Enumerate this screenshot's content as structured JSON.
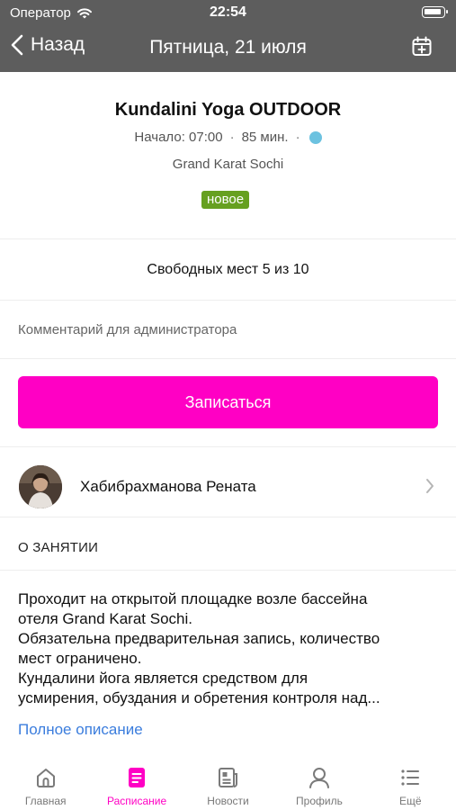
{
  "status_bar": {
    "carrier": "Оператор",
    "time": "22:54"
  },
  "nav": {
    "back_label": "Назад",
    "title": "Пятница, 21 июля"
  },
  "class_info": {
    "title": "Kundalini Yoga OUTDOOR",
    "start": "Начало: 07:00",
    "separator": "·",
    "duration": "85 мин.",
    "location": "Grand Karat Sochi",
    "badge": "новое",
    "dot_color": "#6cc2e0"
  },
  "seats": {
    "text": "Свободных мест 5 из 10"
  },
  "comment": {
    "placeholder": "Комментарий для администратора",
    "value": ""
  },
  "book_button": {
    "label": "Записаться",
    "color": "#ff00c4"
  },
  "trainer": {
    "name": "Хабибрахманова Рената"
  },
  "about": {
    "heading": "О ЗАНЯТИИ",
    "lines": [
      "Проходит на открытой площадке возле бассейна",
      "отеля Grand Karat Sochi.",
      "Обязательна предварительная запись, количество",
      "мест ограничено.",
      "Кундалини йога является средством для",
      "усмирения, обуздания и обретения контроля над..."
    ],
    "more_link": "Полное описание"
  },
  "tabs": [
    {
      "label": "Главная",
      "icon": "home-icon",
      "active": false
    },
    {
      "label": "Расписание",
      "icon": "schedule-icon",
      "active": true
    },
    {
      "label": "Новости",
      "icon": "news-icon",
      "active": false
    },
    {
      "label": "Профиль",
      "icon": "profile-icon",
      "active": false
    },
    {
      "label": "Ещё",
      "icon": "more-icon",
      "active": false
    }
  ],
  "colors": {
    "header_bg": "#5d5d5d",
    "accent": "#ff00c4",
    "badge_bg": "#66a020",
    "link": "#3b7ddd"
  }
}
